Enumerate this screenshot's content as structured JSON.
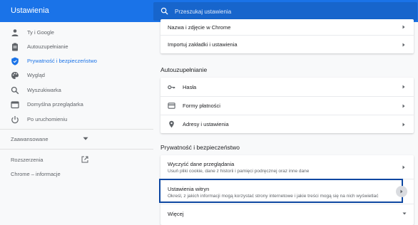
{
  "app": {
    "title": "Ustawienia"
  },
  "search": {
    "placeholder": "Przeszukaj ustawienia"
  },
  "sidebar": {
    "items": [
      {
        "label": "Ty i Google",
        "icon": "person-icon"
      },
      {
        "label": "Autouzupełnianie",
        "icon": "clipboard-icon"
      },
      {
        "label": "Prywatność i bezpieczeństwo",
        "icon": "shield-icon",
        "active": true
      },
      {
        "label": "Wygląd",
        "icon": "palette-icon"
      },
      {
        "label": "Wyszukiwarka",
        "icon": "search-icon"
      },
      {
        "label": "Domyślna przeglądarka",
        "icon": "browser-icon"
      },
      {
        "label": "Po uruchomieniu",
        "icon": "power-icon"
      }
    ],
    "advanced": "Zaawansowane",
    "extensions": "Rozszerzenia",
    "about": "Chrome – informacje"
  },
  "main": {
    "top_rows": [
      {
        "title": "Nazwa i zdjęcie w Chrome"
      },
      {
        "title": "Importuj zakładki i ustawienia"
      }
    ],
    "autofill": {
      "heading": "Autouzupełnianie",
      "rows": [
        {
          "title": "Hasła",
          "icon": "key-icon"
        },
        {
          "title": "Formy płatności",
          "icon": "credit-card-icon"
        },
        {
          "title": "Adresy i ustawienia",
          "icon": "location-pin-icon"
        }
      ]
    },
    "privacy": {
      "heading": "Prywatność i bezpieczeństwo",
      "rows": [
        {
          "title": "Wyczyść dane przeglądania",
          "subtitle": "Usuń pliki cookie, dane z historii i pamięci podręcznej oraz inne dane"
        },
        {
          "title": "Ustawienia witryn",
          "subtitle": "Określ, z jakich informacji mogą korzystać strony internetowe i jakie treści mogą się na nich wyświetlać"
        },
        {
          "title": "Więcej"
        }
      ]
    }
  },
  "colors": {
    "accent": "#1a73e8",
    "highlight": "#0d47a1"
  }
}
